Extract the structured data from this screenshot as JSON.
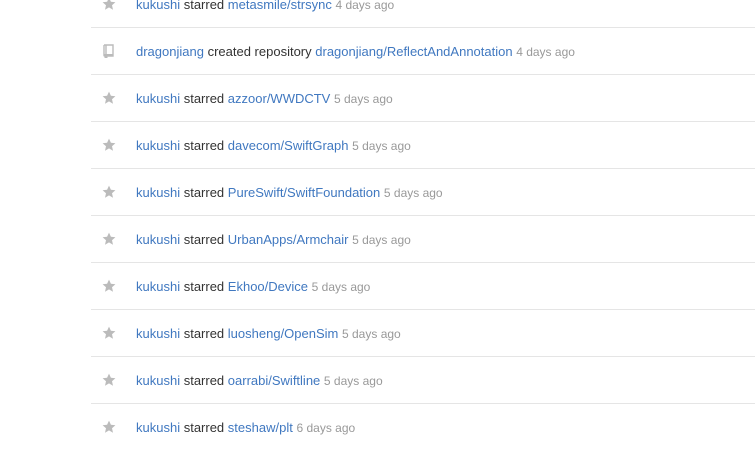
{
  "feed": {
    "items": [
      {
        "icon": "star-icon",
        "user": "kukushi",
        "action": "starred",
        "repo": "metasmile/strsync",
        "time": "4 days ago"
      },
      {
        "icon": "repo-icon",
        "user": "dragonjiang",
        "action": "created repository",
        "repo": "dragonjiang/ReflectAndAnnotation",
        "time": "4 days ago"
      },
      {
        "icon": "star-icon",
        "user": "kukushi",
        "action": "starred",
        "repo": "azzoor/WWDCTV",
        "time": "5 days ago"
      },
      {
        "icon": "star-icon",
        "user": "kukushi",
        "action": "starred",
        "repo": "davecom/SwiftGraph",
        "time": "5 days ago"
      },
      {
        "icon": "star-icon",
        "user": "kukushi",
        "action": "starred",
        "repo": "PureSwift/SwiftFoundation",
        "time": "5 days ago"
      },
      {
        "icon": "star-icon",
        "user": "kukushi",
        "action": "starred",
        "repo": "UrbanApps/Armchair",
        "time": "5 days ago"
      },
      {
        "icon": "star-icon",
        "user": "kukushi",
        "action": "starred",
        "repo": "Ekhoo/Device",
        "time": "5 days ago"
      },
      {
        "icon": "star-icon",
        "user": "kukushi",
        "action": "starred",
        "repo": "luosheng/OpenSim",
        "time": "5 days ago"
      },
      {
        "icon": "star-icon",
        "user": "kukushi",
        "action": "starred",
        "repo": "oarrabi/Swiftline",
        "time": "5 days ago"
      },
      {
        "icon": "star-icon",
        "user": "kukushi",
        "action": "starred",
        "repo": "steshaw/plt",
        "time": "6 days ago"
      }
    ]
  },
  "colors": {
    "link": "#4078c0",
    "muted": "#999999",
    "icon": "#bbbbbb",
    "divider": "#e5e5e5"
  }
}
